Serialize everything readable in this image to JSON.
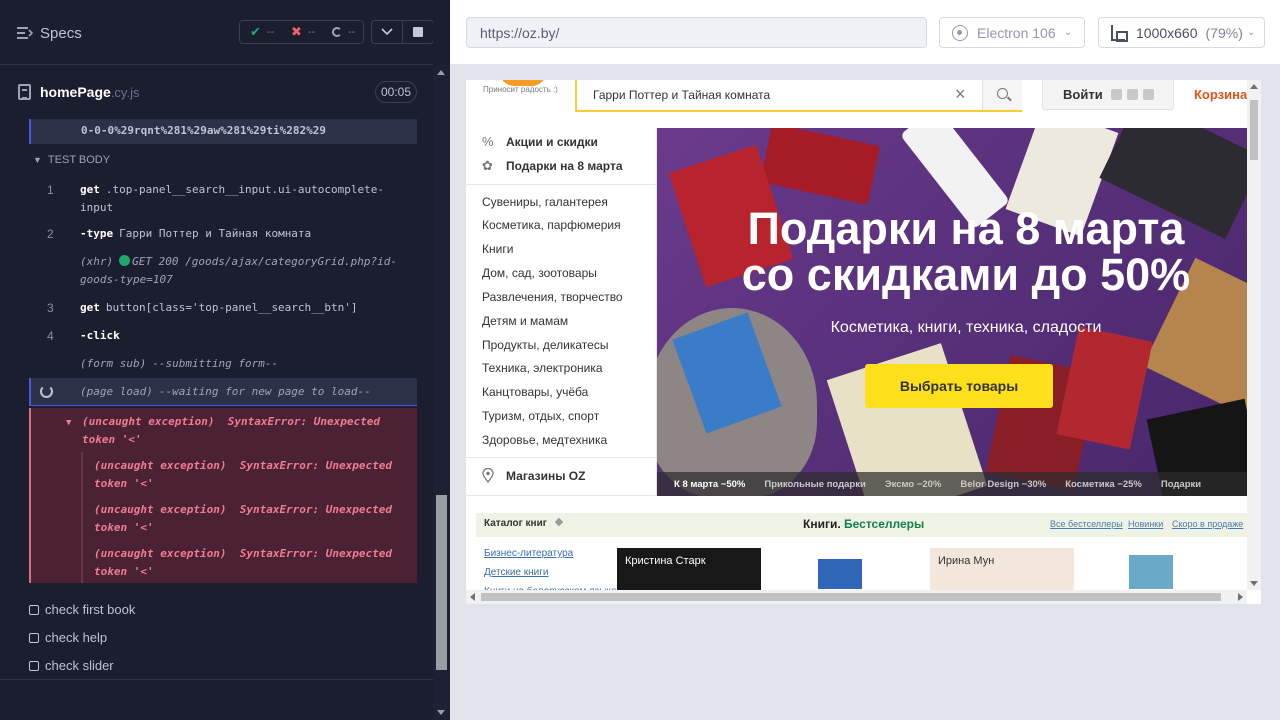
{
  "reporter": {
    "specs_label": "Specs",
    "stats": {
      "passed": "--",
      "failed": "--",
      "pending": "--"
    },
    "spec": {
      "name": "homePage",
      "ext": ".cy.js",
      "duration": "00:05"
    },
    "url_fragment": "0-0-0%29rqnt%281%29aw%281%29ti%282%29",
    "test_body_label": "TEST BODY",
    "commands": [
      {
        "num": "1",
        "name": "get",
        "message": ".top-panel__search__input.ui-autocomplete-input"
      },
      {
        "num": "2",
        "name": "-type",
        "message": "Гарри Поттер и Тайная комната"
      },
      {
        "num": "",
        "name": "(xhr)",
        "message": "GET 200 /goods/ajax/categoryGrid.php?id-goods-type=107"
      },
      {
        "num": "3",
        "name": "get",
        "message": "button[class='top-panel__search__btn']"
      },
      {
        "num": "4",
        "name": "-click",
        "message": ""
      },
      {
        "num": "",
        "name": "(form sub)",
        "message": "--submitting form--"
      },
      {
        "num": "",
        "name": "(page load)",
        "message": "--waiting for new page to load--"
      }
    ],
    "errors": [
      {
        "name": "(uncaught exception)",
        "message": "SyntaxError: Unexpected token '<'"
      },
      {
        "name": "(uncaught exception)",
        "message": "SyntaxError: Unexpected token '<'"
      },
      {
        "name": "(uncaught exception)",
        "message": "SyntaxError: Unexpected token '<'"
      },
      {
        "name": "(uncaught exception)",
        "message": "SyntaxError: Unexpected token '<'"
      }
    ],
    "tests": [
      "check first book",
      "check help",
      "check slider"
    ]
  },
  "aut": {
    "url": "https://oz.by/",
    "browser": "Electron 106",
    "viewport": "1000x660",
    "scale": "(79%)"
  },
  "site": {
    "tagline": "Приносит радость :)",
    "search_value": "Гарри Поттер и Тайная комната",
    "login": "Войти",
    "cart": "Корзина",
    "promos": [
      {
        "icon": "%",
        "label": "Акции и скидки"
      },
      {
        "icon": "✿",
        "label": "Подарки на 8 марта"
      }
    ],
    "categories": [
      "Сувениры, галантерея",
      "Косметика, парфюмерия",
      "Книги",
      "Дом, сад, зоотовары",
      "Развлечения, творчество",
      "Детям и мамам",
      "Продукты, деликатесы",
      "Техника, электроника",
      "Канцтовары, учёба",
      "Туризм, отдых, спорт",
      "Здоровье, медтехника"
    ],
    "stores": "Магазины OZ",
    "banner": {
      "headline_1": "Подарки на 8 марта",
      "headline_2": "со скидками до 50%",
      "subtitle": "Косметика, книги, техника, сладости",
      "cta": "Выбрать товары",
      "tabs": [
        "К 8 марта −50%",
        "Прикольные подарки",
        "Эксмо −20%",
        "Belor Design −30%",
        "Косметика −25%",
        "Подарки"
      ]
    },
    "catalog": {
      "title": "Каталог книг",
      "heading_prefix": "Книги.",
      "heading_accent": "Бестселлеры",
      "links": [
        "Все бестселлеры",
        "Новинки",
        "Скоро в продаже"
      ],
      "side_links": [
        "Бизнес-литература",
        "Детские книги",
        "Книги на белорусском языке"
      ],
      "book1_author": "Кристина Старк",
      "book3_author": "Ирина Мун"
    }
  }
}
